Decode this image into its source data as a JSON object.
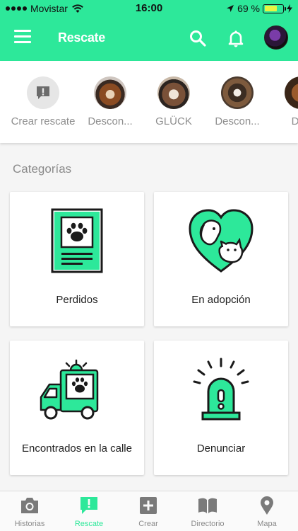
{
  "status": {
    "carrier": "Movistar",
    "time": "16:00",
    "battery": "69 %",
    "battery_level": 0.69
  },
  "header": {
    "title": "Rescate",
    "icons": [
      "menu-icon",
      "search-icon",
      "bell-icon",
      "avatar"
    ]
  },
  "stories": [
    {
      "label": "Crear rescate",
      "icon": "exclamation-icon"
    },
    {
      "label": "Descon..."
    },
    {
      "label": "GLÜCK"
    },
    {
      "label": "Descon..."
    },
    {
      "label": "Des"
    }
  ],
  "categories_title": "Categorías",
  "categories": [
    {
      "label": "Perdidos",
      "icon": "lost-poster-icon"
    },
    {
      "label": "En adopción",
      "icon": "heart-pets-icon"
    },
    {
      "label": "Encontrados en la calle",
      "icon": "rescue-truck-icon"
    },
    {
      "label": "Denunciar",
      "icon": "alarm-siren-icon"
    }
  ],
  "tabs": [
    {
      "label": "Historias",
      "icon": "camera-icon",
      "active": false
    },
    {
      "label": "Rescate",
      "icon": "alert-message-icon",
      "active": true
    },
    {
      "label": "Crear",
      "icon": "plus-square-icon",
      "active": false
    },
    {
      "label": "Directorio",
      "icon": "book-icon",
      "active": false
    },
    {
      "label": "Mapa",
      "icon": "map-pin-icon",
      "active": false
    }
  ],
  "colors": {
    "accent": "#2de89a",
    "icon_dark": "#1a1a1a",
    "muted": "#8e8e8e"
  }
}
